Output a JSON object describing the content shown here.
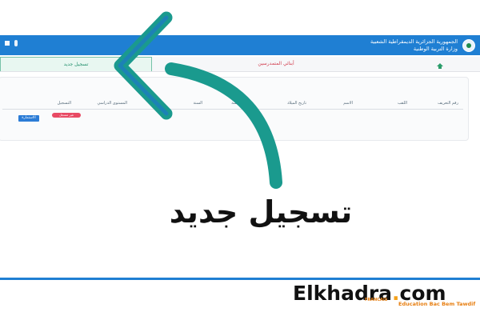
{
  "header": {
    "ministry_line1": "الجمهورية الجزائرية الديمقراطية الشعبية",
    "ministry_line2": "وزارة التربية الوطنية",
    "emblem_icon": "emblem-icon"
  },
  "tabs": [
    {
      "label": "تسجيل جديد",
      "active": true
    },
    {
      "label": "أبنائي المتمدرسين"
    },
    {
      "label": "",
      "icon": "home-icon"
    }
  ],
  "table": {
    "headers": [
      "رقم التعريف",
      "اللقب",
      "الاسم",
      "تاريخ الميلاد",
      "المؤسسة",
      "السنة",
      "المستوى الدراسي",
      "التسجيل"
    ],
    "action_button": "الاستمارة",
    "status_badge": "غير مسجل"
  },
  "overlay": {
    "headline": "تسجيل جديد"
  },
  "brand": {
    "name": "Elkhadra",
    "dot": ".",
    "tld": "com",
    "small": "FRANCAIS",
    "tagline": "Education Bac Bem Tawdif"
  },
  "colors": {
    "appbar": "#1f7fd3",
    "arrow": "#1a9a8e",
    "accent_orange": "#f4a11b"
  }
}
